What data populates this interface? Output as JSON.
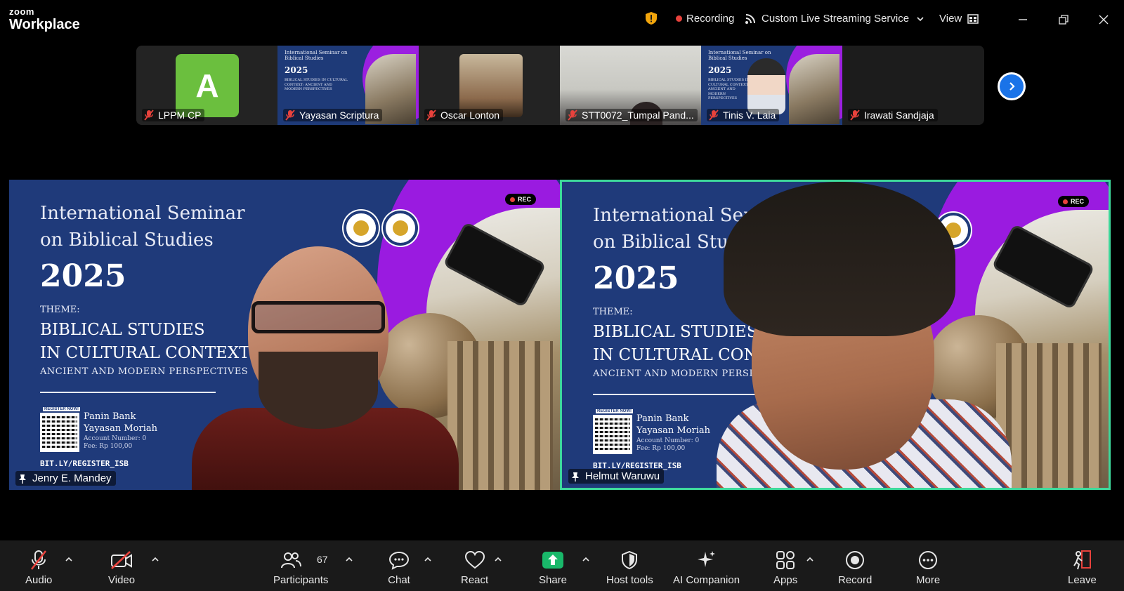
{
  "app": {
    "brand_small": "zoom",
    "brand_large": "Workplace"
  },
  "titlebar": {
    "recording_label": "Recording",
    "streaming_label": "Custom Live Streaming Service",
    "view_label": "View"
  },
  "thumbnails": [
    {
      "name": "LPPM CP",
      "avatar_letter": "A",
      "kind": "avatar"
    },
    {
      "name": "Yayasan Scriptura",
      "kind": "slide"
    },
    {
      "name": "Oscar Lonton",
      "kind": "photo"
    },
    {
      "name": "STT0072_Tumpal Pand...",
      "kind": "camera"
    },
    {
      "name": "Tinis V. Laia",
      "kind": "slide-avatar"
    },
    {
      "name": "Irawati Sandjaja",
      "kind": "none"
    }
  ],
  "slide": {
    "title_line1": "International Seminar",
    "title_line2": "on Biblical Studies",
    "year": "2025",
    "theme_label": "THEME:",
    "theme_line1": "BIBLICAL STUDIES",
    "theme_line2": "IN CULTURAL CONTEXT:",
    "theme_sub": "ANCIENT AND MODERN PERSPECTIVES",
    "register_tag": "REGISTER NOW!",
    "bank": "Panin Bank",
    "account_name": "Yayasan Moriah",
    "account_number": "Account Number: 0",
    "fee": "Fee: Rp 100,00",
    "link": "BIT.LY/REGISTER_ISB",
    "rec_badge": "REC",
    "mini_title": "International Seminar on Biblical Studies",
    "mini_theme": "BIBLICAL STUDIES IN CULTURAL CONTEXT: ANCIENT AND MODERN PERSPECTIVES"
  },
  "tiles": [
    {
      "name": "Jenry E. Mandey"
    },
    {
      "name": "Helmut Waruwu"
    }
  ],
  "toolbar": {
    "audio": "Audio",
    "video": "Video",
    "participants": "Participants",
    "participants_count": "67",
    "chat": "Chat",
    "react": "React",
    "share": "Share",
    "host_tools": "Host tools",
    "ai_companion": "AI Companion",
    "apps": "Apps",
    "record": "Record",
    "more": "More",
    "leave": "Leave"
  },
  "colors": {
    "active_speaker": "#3ed99b",
    "share_green": "#19b86a",
    "next_blue": "#1a73e8",
    "leave_red": "#e8423c"
  }
}
